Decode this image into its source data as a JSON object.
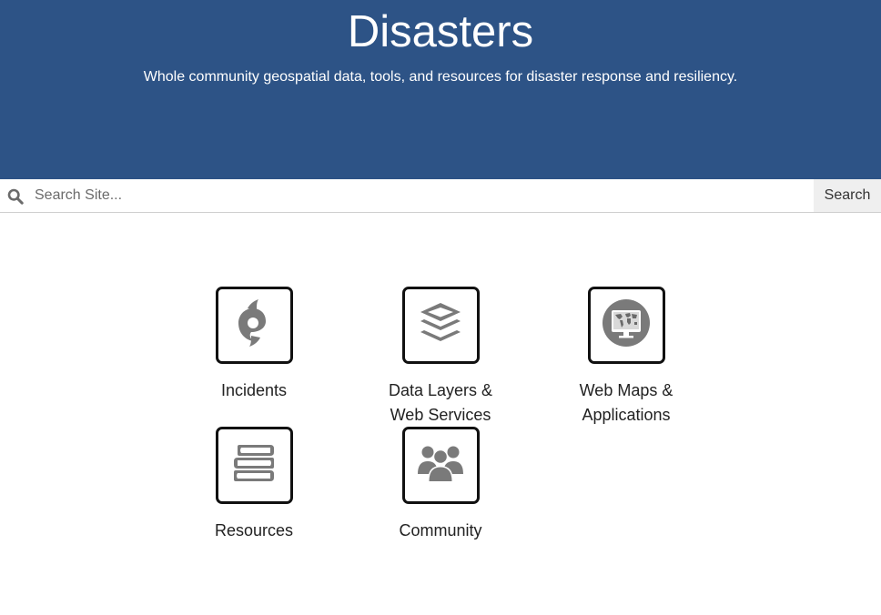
{
  "hero": {
    "title": "Disasters",
    "subtitle": "Whole community geospatial data, tools, and resources for disaster response and resiliency.",
    "background_color": "#2d5386"
  },
  "search": {
    "placeholder": "Search Site...",
    "value": "",
    "button_label": "Search",
    "icon": "search-icon"
  },
  "tiles": [
    {
      "label_line1": "Incidents",
      "label_line2": "",
      "icon": "hurricane-icon"
    },
    {
      "label_line1": "Data Layers &",
      "label_line2": "Web Services",
      "icon": "layers-icon"
    },
    {
      "label_line1": "Web Maps &",
      "label_line2": "Applications",
      "icon": "web-map-icon"
    },
    {
      "label_line1": "Resources",
      "label_line2": "",
      "icon": "books-icon"
    },
    {
      "label_line1": "Community",
      "label_line2": "",
      "icon": "people-icon"
    }
  ],
  "icon_color": "#7a7a7a"
}
